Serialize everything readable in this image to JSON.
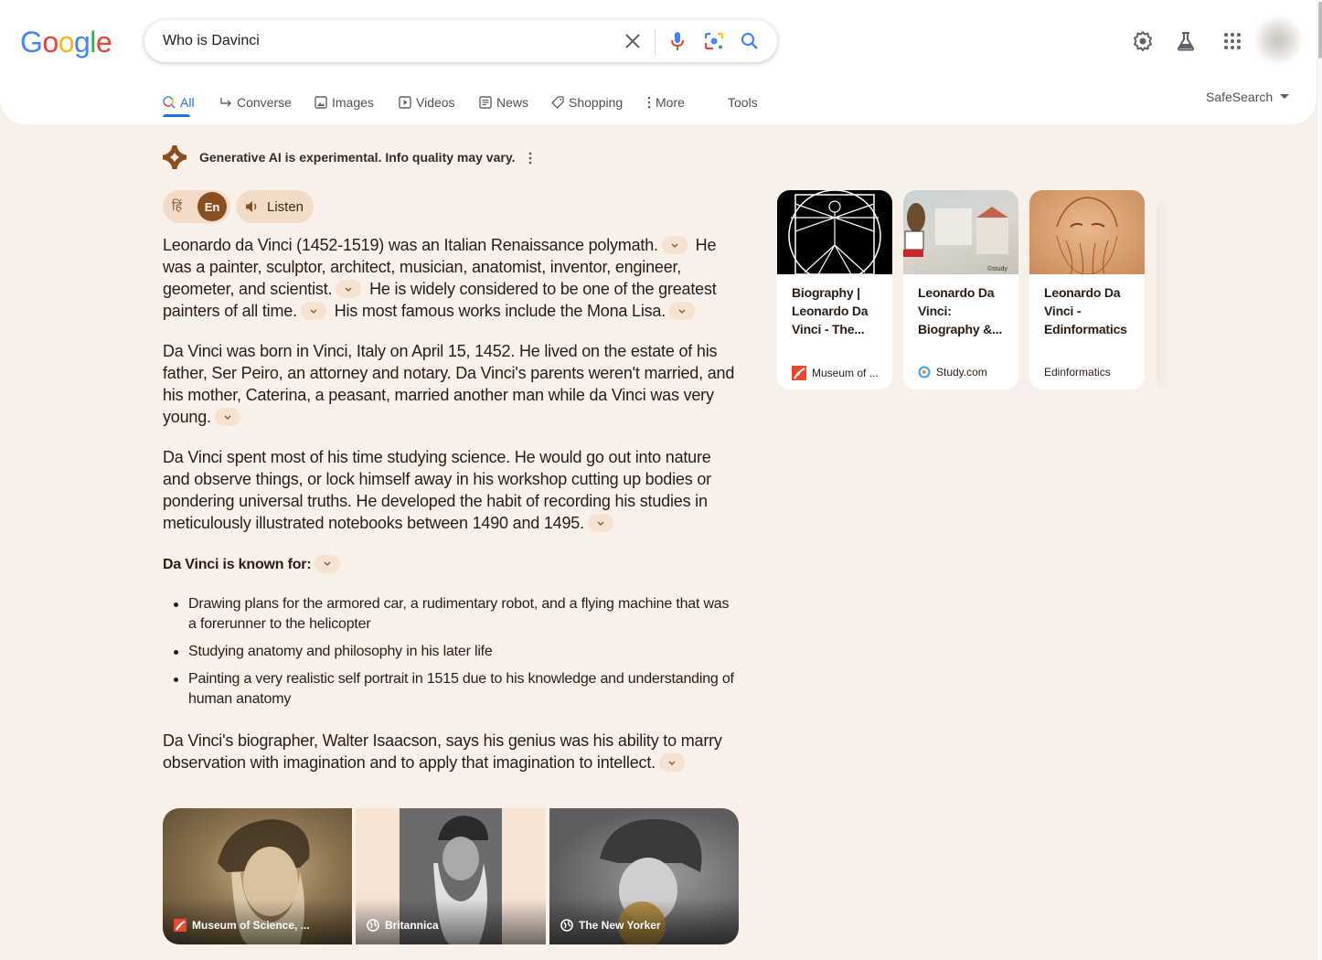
{
  "header": {
    "logo": [
      "G",
      "o",
      "o",
      "g",
      "l",
      "e"
    ],
    "logo_colors": [
      "#4285F4",
      "#EA4335",
      "#FBBC05",
      "#4285F4",
      "#34A853",
      "#EA4335"
    ],
    "search": {
      "value": "Who is Davinci",
      "placeholder": ""
    },
    "icons": [
      "clear-icon",
      "microphone-icon",
      "google-lens-icon",
      "search-icon",
      "settings-icon",
      "labs-icon",
      "apps-icon",
      "avatar"
    ],
    "tabs": [
      {
        "label": "All",
        "icon": "search-icon",
        "active": true
      },
      {
        "label": "Converse",
        "icon": "converse-arrow-icon"
      },
      {
        "label": "Images",
        "icon": "image-icon"
      },
      {
        "label": "Videos",
        "icon": "video-icon"
      },
      {
        "label": "News",
        "icon": "news-icon"
      },
      {
        "label": "Shopping",
        "icon": "tag-icon"
      },
      {
        "label": "More",
        "icon": "more-vertical-icon"
      },
      {
        "label": "Tools"
      }
    ],
    "safesearch_label": "SafeSearch",
    "accent_color": "#1a73e8"
  },
  "ai_overview": {
    "disclaimer": "Generative AI is experimental. Info quality may vary.",
    "lang_hindi": "हिं",
    "lang_english": "En",
    "listen_label": "Listen",
    "paragraphs": [
      {
        "segments": [
          "Leonardo da Vinci (1452-1519) was an Italian Renaissance polymath.",
          "He was a painter, sculptor, architect, musician, anatomist, inventor, engineer, geometer, and scientist.",
          "He is widely considered to be one of the greatest painters of all time.",
          "His most famous works include the Mona Lisa."
        ]
      },
      {
        "segments": [
          "Da Vinci was born in Vinci, Italy on April 15, 1452. He lived on the estate of his father, Ser Peiro, an attorney and notary. Da Vinci's parents weren't married, and his mother, Caterina, a peasant, married another man while da Vinci was very young."
        ]
      },
      {
        "segments": [
          "Da Vinci spent most of his time studying science. He would go out into nature and observe things, or lock himself away in his workshop cutting up bodies or pondering universal truths. He developed the habit of recording his studies in meticulously illustrated notebooks between 1490 and 1495."
        ]
      }
    ],
    "known_for_heading": "Da Vinci is known for:",
    "known_for_items": [
      "Drawing plans for the armored car, a rudimentary robot, and a flying machine that was a forerunner to the helicopter",
      "Studying anatomy and philosophy in his later life",
      "Painting a very realistic self portrait in 1515 due to his knowledge and understanding of human anatomy"
    ],
    "closing": "Da Vinci's biographer, Walter Isaacson, says his genius was his ability to marry observation with imagination and to apply that imagination to intellect.",
    "images": [
      {
        "source": "Museum of Science, ...",
        "icon": "museum-of-science-icon"
      },
      {
        "source": "Britannica",
        "icon": "globe-icon"
      },
      {
        "source": "The New Yorker",
        "icon": "globe-icon"
      }
    ],
    "source_cards": [
      {
        "title": "Biography | Leonardo Da Vinci - The...",
        "source": "Museum of ...",
        "icon": "museum-of-science-icon"
      },
      {
        "title": "Leonardo Da Vinci: Biography &...",
        "source": "Study.com",
        "icon": "study-com-icon"
      },
      {
        "title": "Leonardo Da Vinci - Edinformatics",
        "source": "Edinformatics",
        "icon": ""
      }
    ],
    "brand_color": "#8b4f1f",
    "background_color": "#f9f0ea"
  }
}
